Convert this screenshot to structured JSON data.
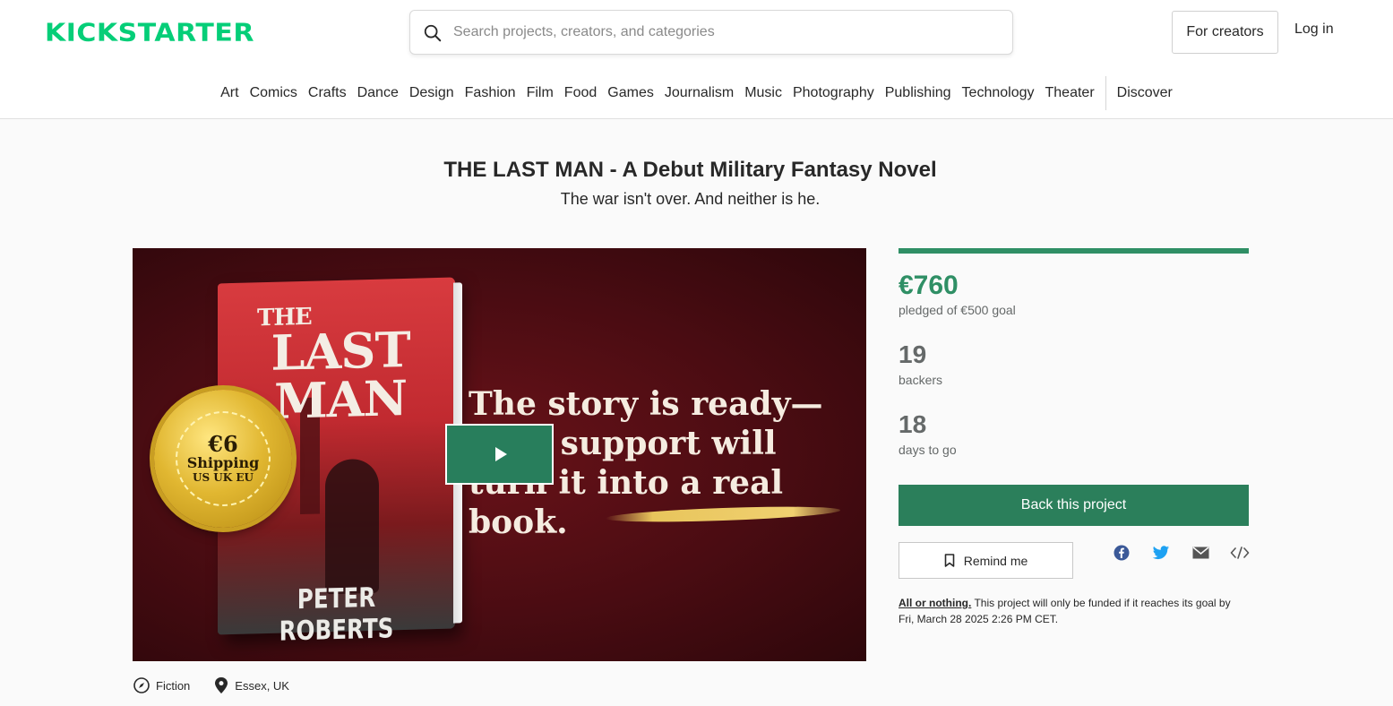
{
  "header": {
    "logo": "KICKSTARTER",
    "search_placeholder": "Search projects, creators, and categories",
    "for_creators": "For creators",
    "login": "Log in"
  },
  "categories": [
    "Art",
    "Comics",
    "Crafts",
    "Dance",
    "Design",
    "Fashion",
    "Film",
    "Food",
    "Games",
    "Journalism",
    "Music",
    "Photography",
    "Publishing",
    "Technology",
    "Theater"
  ],
  "discover": "Discover",
  "project": {
    "title": "THE LAST MAN - A Debut Military Fantasy Novel",
    "subtitle": "The war isn't over. And neither is he.",
    "media": {
      "book_title_small": "THE",
      "book_title_large": "LAST MAN",
      "book_author": "PETER ROBERTS",
      "seal_price": "€6",
      "seal_line1": "Shipping",
      "seal_line2": "US UK EU",
      "tagline": "The story is ready—your support will turn it into a real book."
    },
    "category": "Fiction",
    "location": "Essex, UK"
  },
  "stats": {
    "pledged": "€760",
    "pledged_sub": "pledged of €500 goal",
    "funded_fraction": 1.0,
    "backers": "19",
    "backers_label": "backers",
    "days": "18",
    "days_label": "days to go"
  },
  "actions": {
    "back": "Back this project",
    "remind": "Remind me"
  },
  "all_or_nothing": {
    "link": "All or nothing.",
    "text": "This project will only be funded if it reaches its goal by Fri, March 28 2025 2:26 PM CET."
  },
  "colors": {
    "brand": "#05ce78",
    "accent": "#2b7f5b",
    "facebook": "#3b5998",
    "twitter": "#1da1f2"
  }
}
